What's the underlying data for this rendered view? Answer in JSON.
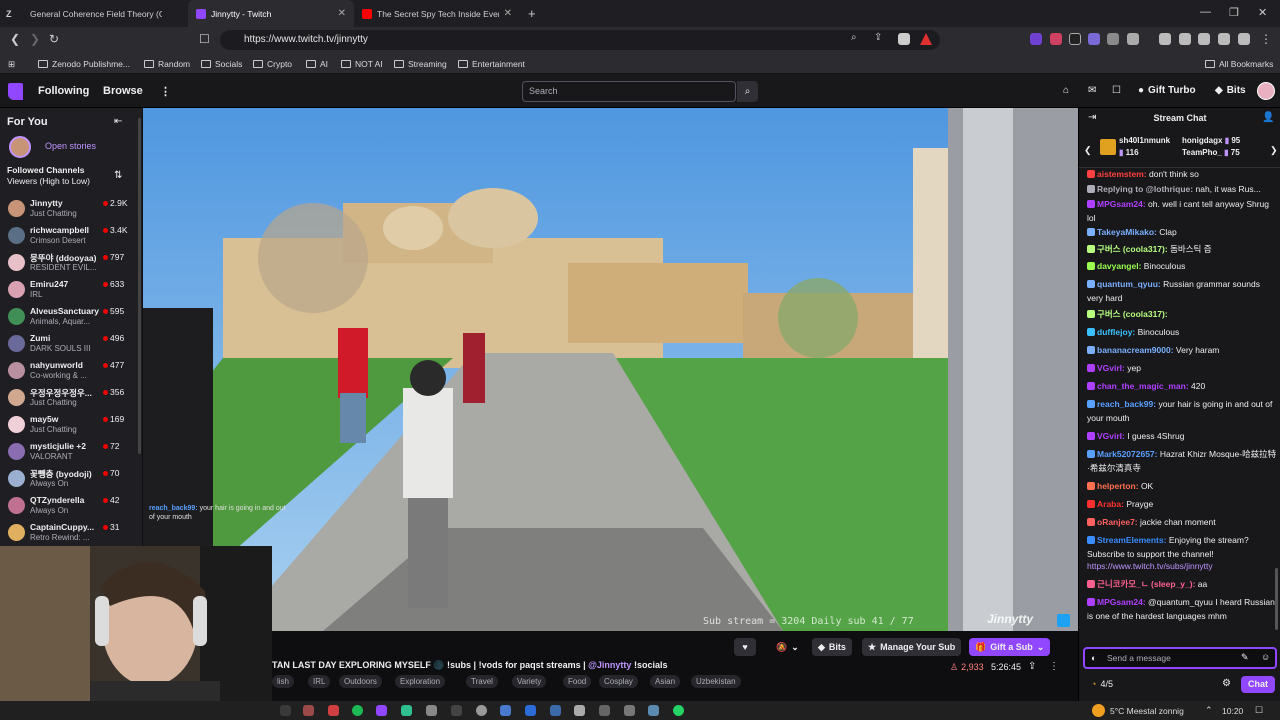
{
  "browser": {
    "tabs": [
      {
        "title": "General Coherence Field Theory (GC",
        "color": "#ffffff"
      },
      {
        "title": "Jinnytty - Twitch",
        "color": "#9147ff"
      },
      {
        "title": "The Secret Spy Tech Inside Every Cre",
        "color": "#ff0000"
      }
    ],
    "url": "https://www.twitch.tv/jinnytty",
    "bookmarks": [
      "Zenodo Publishme...",
      "Random",
      "Socials",
      "Crypto",
      "AI",
      "NOT AI",
      "Streaming",
      "Entertainment"
    ],
    "all_bookmarks": "All Bookmarks"
  },
  "twitch_nav": {
    "following": "Following",
    "browse": "Browse",
    "search_placeholder": "Search",
    "gift_turbo": "Gift Turbo",
    "bits": "Bits"
  },
  "sidebar": {
    "for_you": "For You",
    "open_stories": "Open stories",
    "followed_title": "Followed Channels",
    "sort_label": "Viewers (High to Low)",
    "channels": [
      {
        "name": "Jinnytty",
        "category": "Just Chatting",
        "viewers": "2.9K",
        "color": "#c89478"
      },
      {
        "name": "richwcampbell",
        "category": "Crimson Desert",
        "viewers": "3.4K",
        "color": "#5a6f85"
      },
      {
        "name": "뭉뚜야 (ddooyaa)",
        "category": "RESIDENT EVIL...",
        "viewers": "797",
        "color": "#e8c0c8"
      },
      {
        "name": "Emiru247",
        "category": "IRL",
        "viewers": "633",
        "color": "#d8a0b0"
      },
      {
        "name": "AlveusSanctuary",
        "category": "Animals, Aquar...",
        "viewers": "595",
        "color": "#3f8f56"
      },
      {
        "name": "Zumi",
        "category": "DARK SOULS III",
        "viewers": "496",
        "color": "#6a6a9a"
      },
      {
        "name": "nahyunworld",
        "category": "Co-working & ...",
        "viewers": "477",
        "color": "#b890a0"
      },
      {
        "name": "우정우정우정우...",
        "category": "Just Chatting",
        "viewers": "356",
        "color": "#d0a890"
      },
      {
        "name": "may5w",
        "category": "Just Chatting",
        "viewers": "169",
        "color": "#f0d0d8"
      },
      {
        "name": "mysticjulie +2",
        "category": "VALORANT",
        "viewers": "72",
        "color": "#8a6cb0"
      },
      {
        "name": "꽃뺑충 (byodoji)",
        "category": "Always On",
        "viewers": "70",
        "color": "#9bb0d0"
      },
      {
        "name": "QTZynderella",
        "category": "Always On",
        "viewers": "42",
        "color": "#c07090"
      },
      {
        "name": "CaptainCuppy...",
        "category": "Retro Rewind: ...",
        "viewers": "31",
        "color": "#e0b060"
      }
    ]
  },
  "video": {
    "overlay_text": "Sub stream = 3204   Daily sub 41 / 77",
    "watermark": "Jinnytty",
    "overlay_chat_user": "reach_back99:",
    "overlay_chat_msg": "your hair is going in and out of your mouth"
  },
  "stream_info": {
    "title": "TAN LAST DAY EXPLORING MYSELF 🌑 !subs | !vods for paqst streams |",
    "handle": "@Jinnytty",
    "socials": "!socials",
    "viewers": "2,933",
    "uptime": "5:26:45",
    "bits_label": "Bits",
    "manage_sub": "Manage Your Sub",
    "gift_sub": "Gift a Sub",
    "tags": [
      "lish",
      "IRL",
      "Outdoors",
      "Exploration",
      "Travel",
      "Variety",
      "Food",
      "Cosplay",
      "Asian",
      "Uzbekistan"
    ]
  },
  "chat": {
    "title": "Stream Chat",
    "leaders": [
      {
        "name": "sh40l1nmunk",
        "value": "116"
      },
      {
        "name": "honigdagx",
        "value": "95"
      },
      {
        "name": "TeamPho_",
        "value": "75"
      }
    ],
    "messages": [
      {
        "user": "aistemstem:",
        "text": "don't think so",
        "color": "#ff4040"
      },
      {
        "user": "Replying to @lothrique:",
        "text": "nah, it was Rus...",
        "color": "#adadb8"
      },
      {
        "user": "MPGsam24:",
        "text": "oh. well i cant tell anyway Shrug lol",
        "color": "#b040ff"
      },
      {
        "user": "TakeyaMikako:",
        "text": "Clap",
        "color": "#7ab0ff"
      },
      {
        "user": "구버스 (coola317):",
        "text": "돔바스틱 즘",
        "color": "#b8ff80"
      },
      {
        "user": "davyangel:",
        "text": "Binoculous",
        "color": "#9aff50"
      },
      {
        "user": "quantum_qyuu:",
        "text": "Russian grammar sounds very hard",
        "color": "#7ab0ff"
      },
      {
        "user": "구버스 (coola317):",
        "text": "",
        "color": "#b8ff80"
      },
      {
        "user": "dufflejoy:",
        "text": "Binoculous",
        "color": "#3ac0ff"
      },
      {
        "user": "bananacream9000:",
        "text": "Very haram",
        "color": "#7ab0ff"
      },
      {
        "user": "VGvirl:",
        "text": "yep",
        "color": "#b040ff"
      },
      {
        "user": "chan_the_magic_man:",
        "text": "420",
        "color": "#b040ff"
      },
      {
        "user": "reach_back99:",
        "text": "your hair is going in and out of your mouth",
        "color": "#5aa0ff"
      },
      {
        "user": "VGvirl:",
        "text": "I guess 4Shrug",
        "color": "#b040ff"
      },
      {
        "user": "Mark52072657:",
        "text": "Hazrat Khizr Mosque-哈兹拉特·希兹尔清真寺",
        "color": "#5aa0ff"
      },
      {
        "user": "helperton:",
        "text": "OK",
        "color": "#ff7050"
      },
      {
        "user": "Araba:",
        "text": "Prayge",
        "color": "#ff3030"
      },
      {
        "user": "oRanjee7:",
        "text": "jackie chan moment",
        "color": "#ff6060"
      },
      {
        "user": "StreamElements:",
        "text": "Enjoying the stream? Subscribe to support the channel!",
        "color": "#3a8dff"
      },
      {
        "user": "",
        "text": "https://www.twitch.tv/subs/jinnytty",
        "color": "#bf94ff"
      },
      {
        "user": "근니코카모_ㄴ (sleep_y_):",
        "text": "aa",
        "color": "#ff6090"
      },
      {
        "user": "MPGsam24:",
        "text": "@quantum_qyuu I heard Russian is one of the hardest languages mhm",
        "color": "#b040ff"
      }
    ],
    "input_placeholder": "Send a message",
    "points": "4/5",
    "chat_button": "Chat"
  },
  "taskbar": {
    "weather": "5°C  Meestal zonnig",
    "time": "10:20"
  }
}
